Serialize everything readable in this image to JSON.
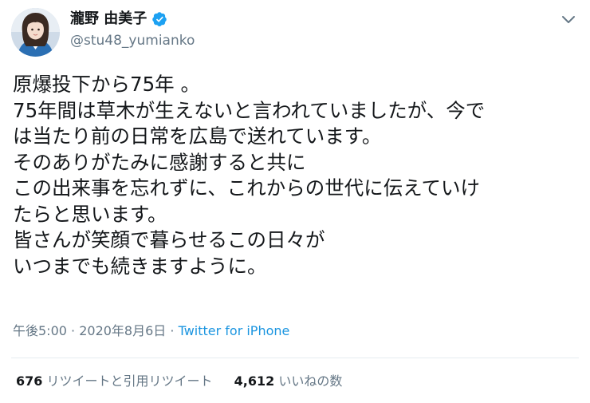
{
  "user": {
    "display_name": "瀧野 由美子",
    "handle": "@stu48_yumianko",
    "verified": true,
    "avatar_icon": "profile-photo",
    "verified_icon": "verified-badge-icon",
    "menu_icon": "chevron-down-icon"
  },
  "tweet": {
    "lines": [
      "原爆投下から75年 。",
      "75年間は草木が生えないと言われていましたが、今で",
      "は当たり前の日常を広島で送れています。",
      "そのありがたみに感謝すると共に",
      "この出来事を忘れずに、これからの世代に伝えていけ",
      "たらと思います。",
      "皆さんが笑顔で暮らせるこの日々が",
      "いつまでも続きますように。"
    ]
  },
  "meta": {
    "time": "午後5:00",
    "separator": " · ",
    "date": "2020年8月6日",
    "source": "Twitter for iPhone"
  },
  "stats": {
    "retweet_count": "676",
    "retweet_label": "リツイートと引用リツイート",
    "like_count": "4,612",
    "like_label": "いいねの数"
  },
  "colors": {
    "text": "#14171a",
    "secondary": "#657786",
    "link": "#1b95e0",
    "verified": "#1da1f2",
    "divider": "#e6ecf0"
  }
}
